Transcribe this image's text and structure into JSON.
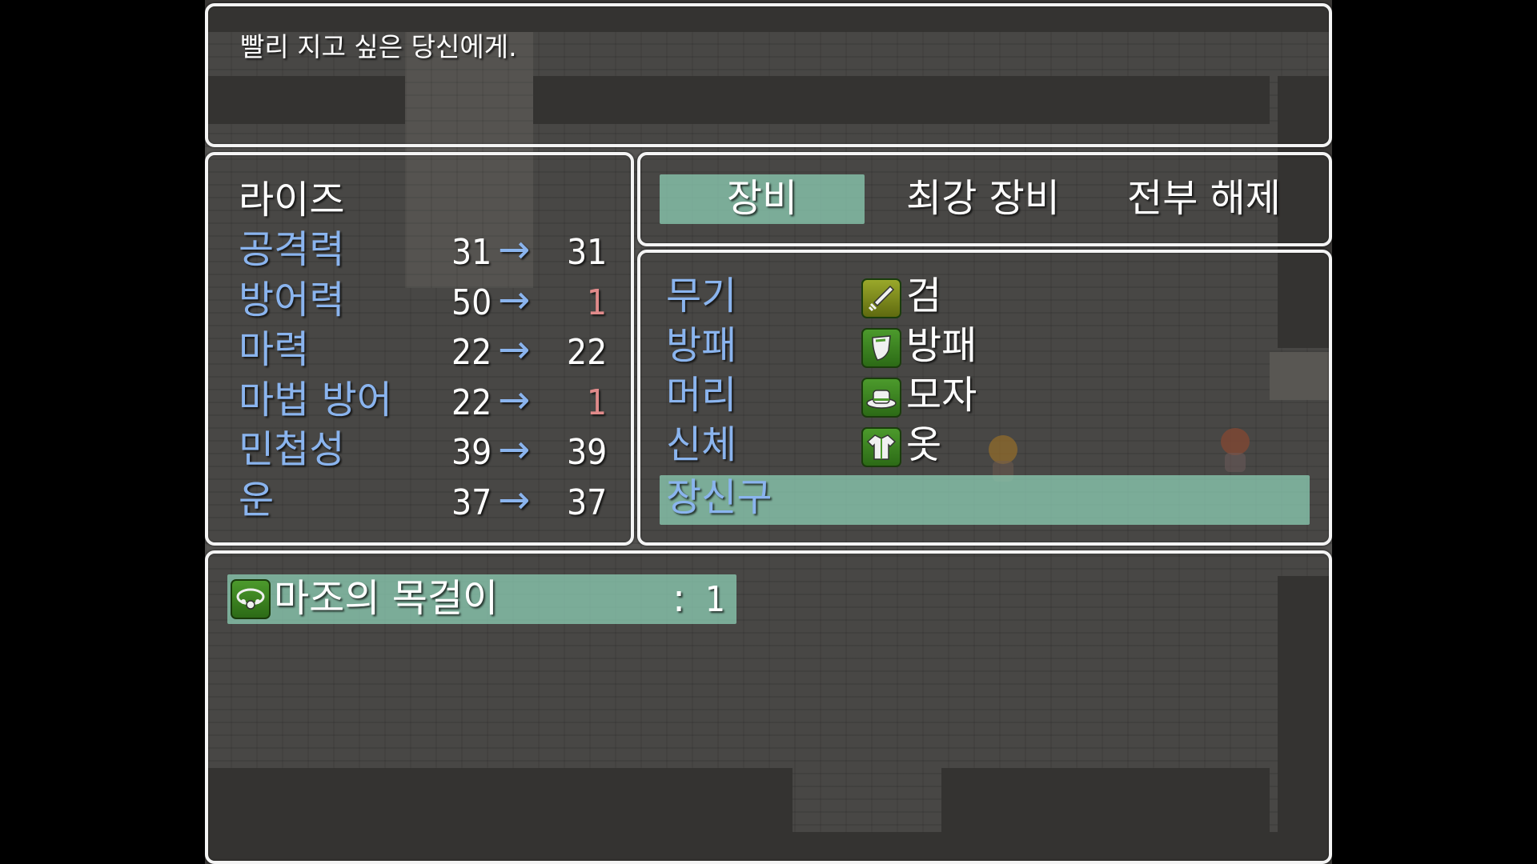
{
  "help": {
    "text": "빨리 지고 싶은 당신에게."
  },
  "status": {
    "actor_name": "라이즈",
    "stats": [
      {
        "label": "공격력",
        "current": "31",
        "arrow": "→",
        "new": "31",
        "new_color": "white"
      },
      {
        "label": "방어력",
        "current": "50",
        "arrow": "→",
        "new": "1",
        "new_color": "red"
      },
      {
        "label": "마력",
        "current": "22",
        "arrow": "→",
        "new": "22",
        "new_color": "white"
      },
      {
        "label": "마법 방어",
        "current": "22",
        "arrow": "→",
        "new": "1",
        "new_color": "red"
      },
      {
        "label": "민첩성",
        "current": "39",
        "arrow": "→",
        "new": "39",
        "new_color": "white"
      },
      {
        "label": "운",
        "current": "37",
        "arrow": "→",
        "new": "37",
        "new_color": "white"
      }
    ]
  },
  "commands": {
    "items": [
      "장비",
      "최강 장비",
      "전부 해제"
    ],
    "selected": 0
  },
  "slots": {
    "items": [
      {
        "slot": "무기",
        "equip": "검",
        "icon": "sword-icon"
      },
      {
        "slot": "방패",
        "equip": "방패",
        "icon": "shield-icon"
      },
      {
        "slot": "머리",
        "equip": "모자",
        "icon": "hat-icon"
      },
      {
        "slot": "신체",
        "equip": "옷",
        "icon": "clothes-icon"
      },
      {
        "slot": "장신구",
        "equip": "",
        "icon": ""
      }
    ],
    "selected": 4
  },
  "item_list": {
    "items": [
      {
        "name": "마조의 목걸이",
        "sep": ":",
        "count": "1",
        "icon": "necklace-icon"
      }
    ],
    "selected": 0
  },
  "colors": {
    "system_blue": "#8ab4ee",
    "power_down": "#e08a8a",
    "cursor": "#8ccdb4",
    "window_border": "#f4f4f4"
  }
}
